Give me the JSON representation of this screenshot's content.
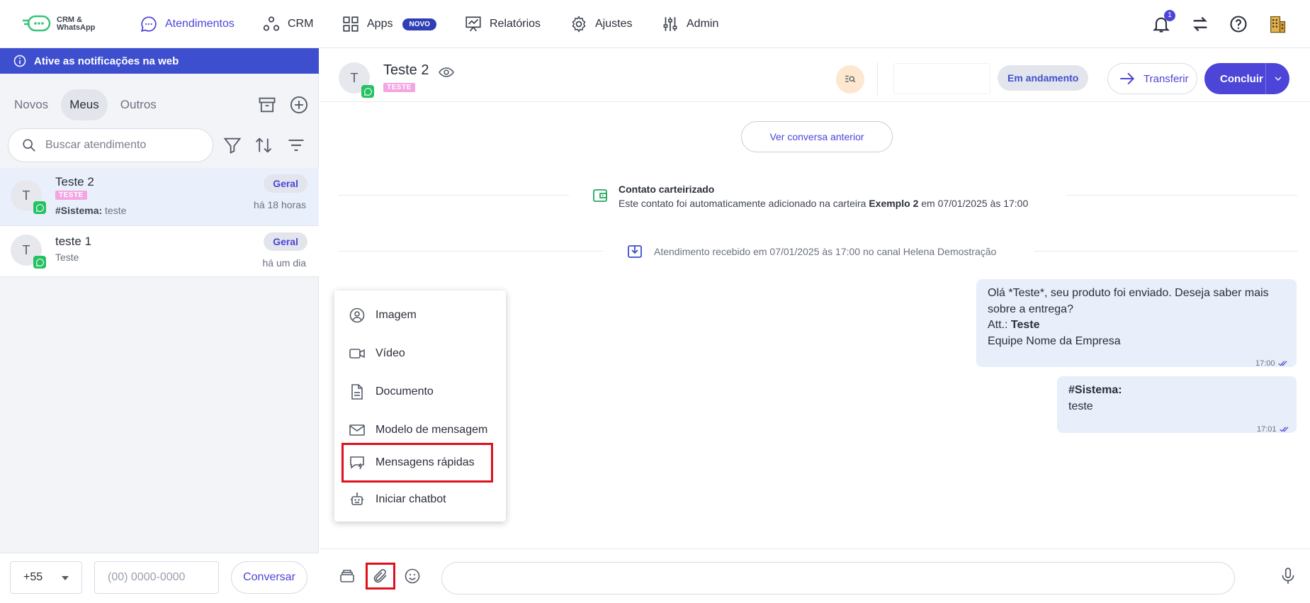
{
  "topnav": {
    "logo_line1": "CRM &",
    "logo_line2": "WhatsApp",
    "items": [
      {
        "label": "Atendimentos"
      },
      {
        "label": "CRM"
      },
      {
        "label": "Apps",
        "badge": "NOVO"
      },
      {
        "label": "Relatórios"
      },
      {
        "label": "Ajustes"
      },
      {
        "label": "Admin"
      }
    ],
    "notification_count": "1"
  },
  "sidebar": {
    "notification_bar": "Ative as notificações na web",
    "tabs": [
      {
        "label": "Novos"
      },
      {
        "label": "Meus"
      },
      {
        "label": "Outros"
      }
    ],
    "search_placeholder": "Buscar atendimento",
    "conversations": [
      {
        "initial": "T",
        "name": "Teste 2",
        "tag": "TESTE",
        "preview_prefix": "#Sistema:",
        "preview": " teste",
        "queue": "Geral",
        "time": "há 18 horas"
      },
      {
        "initial": "T",
        "name": "teste 1",
        "preview": "Teste",
        "queue": "Geral",
        "time": "há um dia"
      }
    ],
    "country_code": "+55",
    "phone_placeholder": "(00) 0000-0000",
    "start_button": "Conversar"
  },
  "chat": {
    "header": {
      "initial": "T",
      "name": "Teste 2",
      "tag": "TESTE",
      "status": "Em andamento",
      "transfer": "Transferir",
      "conclude": "Concluir"
    },
    "prev_button": "Ver conversa anterior",
    "system1": {
      "title": "Contato carteirizado",
      "text_before": "Este contato foi automaticamente adicionado na carteira ",
      "text_bold": "Exemplo 2",
      "text_after": " em 07/01/2025 às 17:00"
    },
    "system2": {
      "text": "Atendimento recebido em 07/01/2025 às 17:00 no canal Helena Demostração"
    },
    "messages": [
      {
        "line1": "Olá *Teste*, seu produto foi enviado. Deseja saber mais",
        "line2": "sobre a entrega?",
        "line3_prefix": "Att.: ",
        "line3_bold": "Teste",
        "line4": "Equipe Nome da Empresa",
        "time": "17:00"
      },
      {
        "bold": "#Sistema:",
        "text": "teste",
        "time": "17:01"
      }
    ],
    "attach_menu": [
      {
        "label": "Imagem",
        "icon": "image-icon"
      },
      {
        "label": "Vídeo",
        "icon": "video-icon"
      },
      {
        "label": "Documento",
        "icon": "document-icon"
      },
      {
        "label": "Modelo de mensagem",
        "icon": "mail-icon"
      },
      {
        "label": "Mensagens rápidas",
        "icon": "quick-message-icon"
      },
      {
        "label": "Iniciar chatbot",
        "icon": "robot-icon"
      }
    ],
    "composer_placeholder": ""
  },
  "colors": {
    "accent": "#4c45d8",
    "notif_bar": "#3d4fcf",
    "highlight": "#e0111c",
    "whatsapp": "#25c163"
  }
}
